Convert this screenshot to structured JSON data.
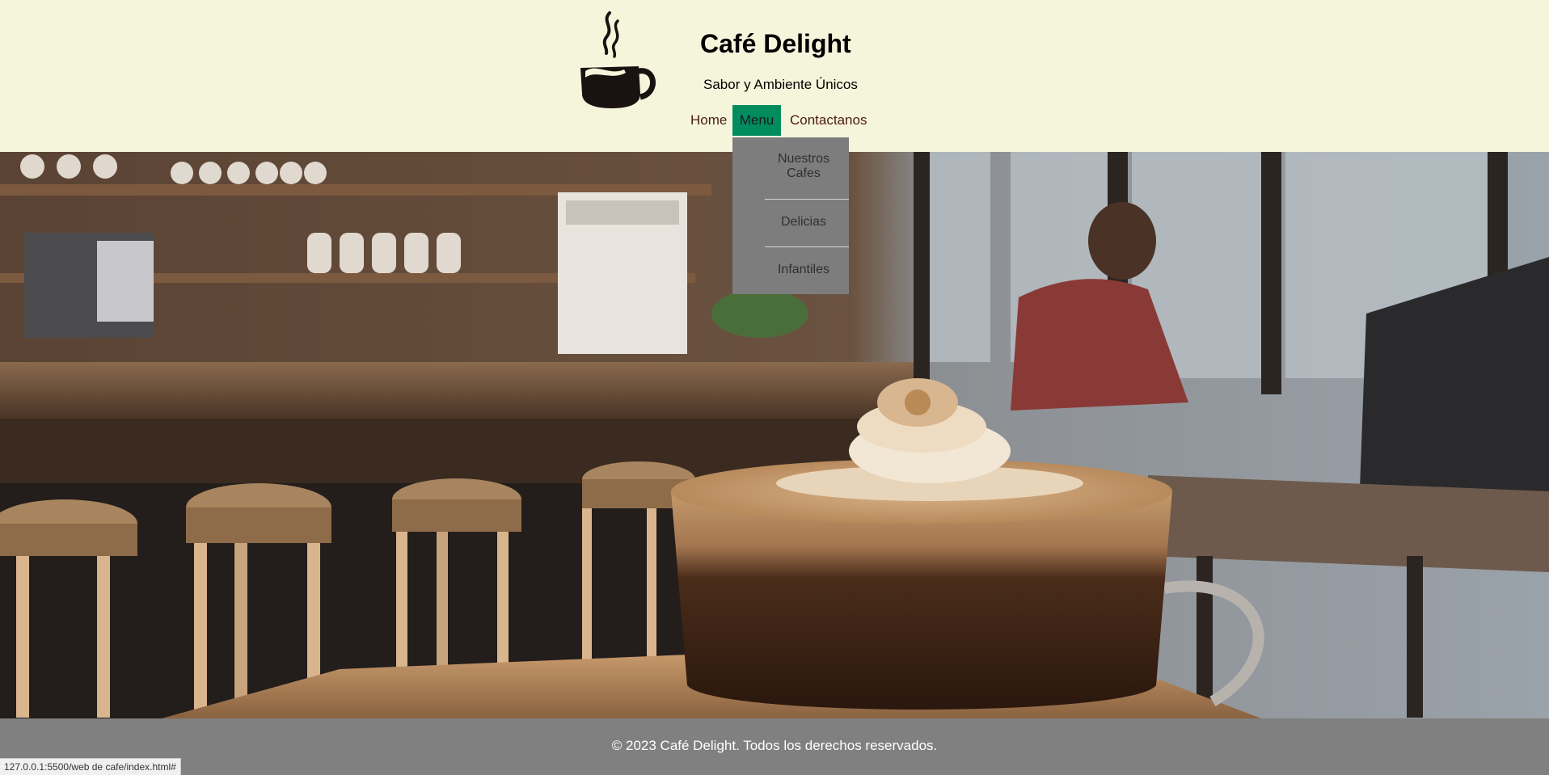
{
  "header": {
    "title": "Café Delight",
    "tagline": "Sabor y Ambiente Únicos"
  },
  "nav": {
    "items": [
      {
        "label": "Home",
        "active": false
      },
      {
        "label": "Menu",
        "active": true
      },
      {
        "label": "Contactanos",
        "active": false
      }
    ]
  },
  "dropdown": {
    "items": [
      {
        "label": "Nuestros Cafes"
      },
      {
        "label": "Delicias"
      },
      {
        "label": "Infantiles"
      }
    ]
  },
  "footer": {
    "text": "© 2023 Café Delight. Todos los derechos reservados."
  },
  "status_bar": {
    "url": "127.0.0.1:5500/web de cafe/index.html#"
  },
  "colors": {
    "header_bg": "#f5f5dc",
    "nav_active_bg": "#008c5f",
    "dropdown_bg": "#7d7d7d",
    "footer_bg": "#808080"
  },
  "hero_image": {
    "icon": "cafe-latte-photo"
  },
  "logo": {
    "icon": "coffee-cup-icon"
  }
}
